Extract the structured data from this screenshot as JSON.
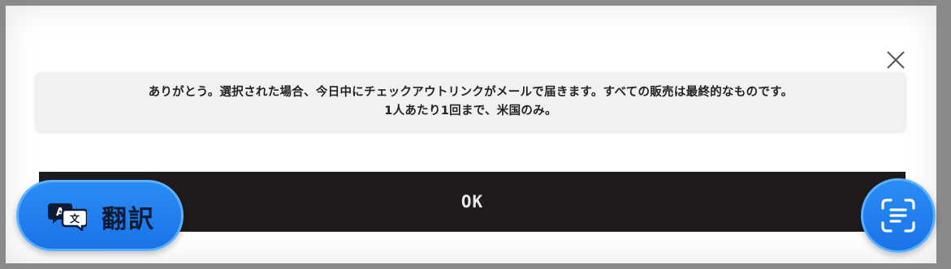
{
  "dialog": {
    "message_line1": "ありがとう。選択された場合、今日中にチェックアウトリンクがメールで届きます。すべての販売は最終的なものです。",
    "message_line2": "1人あたり1回まで、米国のみ。",
    "ok_label": "OK",
    "close_icon": "close-icon"
  },
  "overlay": {
    "translate_label": "翻訳",
    "translate_icon": "translate-icon",
    "scan_icon": "scan-text-icon"
  },
  "colors": {
    "button_blue": "#1a73e8",
    "ok_background": "#1f1b1d",
    "notice_background": "#f1f1f1"
  }
}
